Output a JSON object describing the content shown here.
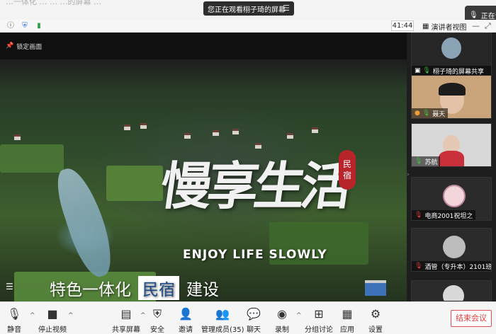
{
  "top": {
    "faint_text": "…一体化  …  …  …的屏幕  …",
    "share_banner": "您正在观看栩子琦的屏幕",
    "speaker_label": "正在讲话"
  },
  "info_bar": {
    "timer": "41:44",
    "view_label": "演讲者视图"
  },
  "stage": {
    "lock_label": "锁定画面",
    "calligraphy": "慢享生活",
    "seal": [
      "民",
      "宿"
    ],
    "slogan": "ENJOY LIFE SLOWLY",
    "subtitle_left": "特色一体化",
    "subtitle_box": "民宿",
    "subtitle_right": "建设"
  },
  "gallery": {
    "tiles": [
      {
        "name": "栩子琦的屏幕共享"
      },
      {
        "name": "聂天"
      },
      {
        "name": "苏航"
      },
      {
        "name": "电商2001祝坦之"
      },
      {
        "name": "酒管（专升本）2101班..."
      }
    ]
  },
  "toolbar": {
    "mute": "静音",
    "stop_video": "停止视频",
    "share_screen": "共享屏幕",
    "security": "安全",
    "invite": "邀请",
    "participants": "管理成员(35)",
    "chat": "聊天",
    "record": "录制",
    "breakout": "分组讨论",
    "apps": "应用",
    "settings": "设置",
    "end_meeting": "结束会议"
  },
  "colors": {
    "accent_red": "#e03b3b",
    "mic_green": "#3fbf3f",
    "subtitle_box_text": "#1c4a86"
  }
}
